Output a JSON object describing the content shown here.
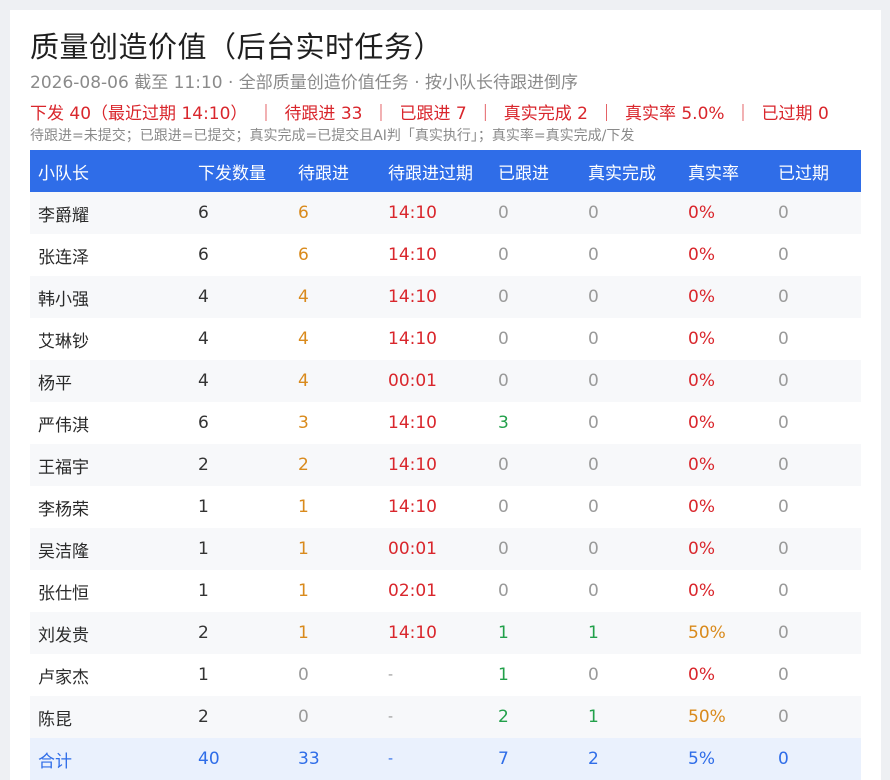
{
  "page": {
    "title": "质量创造价值（后台实时任务）",
    "subtitle": "2026-08-06 截至 11:10 · 全部质量创造价值任务 · 按小队长待跟进倒序",
    "summary": {
      "issued": "下发 40（最近过期 14:10）",
      "pending": "待跟进 33",
      "followed": "已跟进 7",
      "real_done": "真实完成 2",
      "real_rate": "真实率 5.0%",
      "expired": "已过期 0",
      "sep": "｜"
    },
    "legend": "待跟进=未提交；已跟进=已提交；真实完成=已提交且AI判「真实执行」；真实率=真实完成/下发"
  },
  "colors": {
    "header_bg": "#2f6de8",
    "pending": "#d98a1c",
    "overdue": "#d9262c",
    "followed": "#22a04a",
    "total": "#2f6de8"
  },
  "table": {
    "headers": [
      "小队长",
      "下发数量",
      "待跟进",
      "待跟进过期",
      "已跟进",
      "真实完成",
      "真实率",
      "已过期"
    ],
    "rows": [
      {
        "name": "李爵耀",
        "issued": "6",
        "pending": "6",
        "deadline": "14:10",
        "followed": "0",
        "done": "0",
        "rate": "0%",
        "expired": "0"
      },
      {
        "name": "张连泽",
        "issued": "6",
        "pending": "6",
        "deadline": "14:10",
        "followed": "0",
        "done": "0",
        "rate": "0%",
        "expired": "0"
      },
      {
        "name": "韩小强",
        "issued": "4",
        "pending": "4",
        "deadline": "14:10",
        "followed": "0",
        "done": "0",
        "rate": "0%",
        "expired": "0"
      },
      {
        "name": "艾琳钞",
        "issued": "4",
        "pending": "4",
        "deadline": "14:10",
        "followed": "0",
        "done": "0",
        "rate": "0%",
        "expired": "0"
      },
      {
        "name": "杨平",
        "issued": "4",
        "pending": "4",
        "deadline": "00:01",
        "followed": "0",
        "done": "0",
        "rate": "0%",
        "expired": "0"
      },
      {
        "name": "严伟淇",
        "issued": "6",
        "pending": "3",
        "deadline": "14:10",
        "followed": "3",
        "done": "0",
        "rate": "0%",
        "expired": "0"
      },
      {
        "name": "王福宇",
        "issued": "2",
        "pending": "2",
        "deadline": "14:10",
        "followed": "0",
        "done": "0",
        "rate": "0%",
        "expired": "0"
      },
      {
        "name": "李杨荣",
        "issued": "1",
        "pending": "1",
        "deadline": "14:10",
        "followed": "0",
        "done": "0",
        "rate": "0%",
        "expired": "0"
      },
      {
        "name": "吴洁隆",
        "issued": "1",
        "pending": "1",
        "deadline": "00:01",
        "followed": "0",
        "done": "0",
        "rate": "0%",
        "expired": "0"
      },
      {
        "name": "张仕恒",
        "issued": "1",
        "pending": "1",
        "deadline": "02:01",
        "followed": "0",
        "done": "0",
        "rate": "0%",
        "expired": "0"
      },
      {
        "name": "刘发贵",
        "issued": "2",
        "pending": "1",
        "deadline": "14:10",
        "followed": "1",
        "done": "1",
        "rate": "50%",
        "expired": "0"
      },
      {
        "name": "卢家杰",
        "issued": "1",
        "pending": "0",
        "deadline": "-",
        "followed": "1",
        "done": "0",
        "rate": "0%",
        "expired": "0"
      },
      {
        "name": "陈昆",
        "issued": "2",
        "pending": "0",
        "deadline": "-",
        "followed": "2",
        "done": "1",
        "rate": "50%",
        "expired": "0"
      }
    ],
    "total": {
      "name": "合计",
      "issued": "40",
      "pending": "33",
      "deadline": "-",
      "followed": "7",
      "done": "2",
      "rate": "5%",
      "expired": "0"
    }
  }
}
